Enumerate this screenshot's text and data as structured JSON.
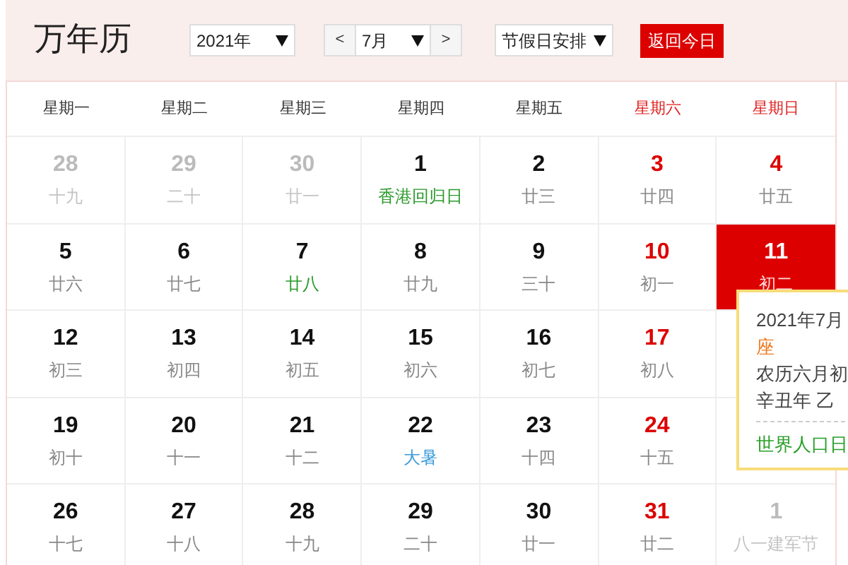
{
  "title": "万年历",
  "controls": {
    "year": "2021年",
    "prev": "<",
    "month": "7月",
    "next": ">",
    "holidays": "节假日安排",
    "today_button": "返回今日"
  },
  "weekdays": [
    {
      "label": "星期一",
      "weekend": false
    },
    {
      "label": "星期二",
      "weekend": false
    },
    {
      "label": "星期三",
      "weekend": false
    },
    {
      "label": "星期四",
      "weekend": false
    },
    {
      "label": "星期五",
      "weekend": false
    },
    {
      "label": "星期六",
      "weekend": true
    },
    {
      "label": "星期日",
      "weekend": true
    }
  ],
  "weeks": [
    [
      {
        "day": "28",
        "lunar": "十九",
        "other_month": true,
        "selected": false
      },
      {
        "day": "29",
        "lunar": "二十",
        "other_month": true,
        "selected": false
      },
      {
        "day": "30",
        "lunar": "廿一",
        "other_month": true,
        "selected": false
      },
      {
        "day": "1",
        "lunar": "香港回归日",
        "other_month": false,
        "selected": false,
        "color": "#2a9a2a"
      },
      {
        "day": "2",
        "lunar": "廿三",
        "other_month": false,
        "selected": false
      },
      {
        "day": "3",
        "lunar": "廿四",
        "other_month": false,
        "selected": false
      },
      {
        "day": "4",
        "lunar": "廿五",
        "other_month": false,
        "selected": false
      }
    ],
    [
      {
        "day": "5",
        "lunar": "廿六",
        "other_month": false,
        "selected": false
      },
      {
        "day": "6",
        "lunar": "廿七",
        "other_month": false,
        "selected": false
      },
      {
        "day": "7",
        "lunar": "廿八",
        "other_month": false,
        "selected": false,
        "color": "#2a9a2a"
      },
      {
        "day": "8",
        "lunar": "廿九",
        "other_month": false,
        "selected": false
      },
      {
        "day": "9",
        "lunar": "三十",
        "other_month": false,
        "selected": false
      },
      {
        "day": "10",
        "lunar": "初一",
        "other_month": false,
        "selected": false
      },
      {
        "day": "11",
        "lunar": "初二",
        "other_month": false,
        "selected": true
      }
    ],
    [
      {
        "day": "12",
        "lunar": "初三",
        "other_month": false,
        "selected": false
      },
      {
        "day": "13",
        "lunar": "初四",
        "other_month": false,
        "selected": false
      },
      {
        "day": "14",
        "lunar": "初五",
        "other_month": false,
        "selected": false
      },
      {
        "day": "15",
        "lunar": "初六",
        "other_month": false,
        "selected": false
      },
      {
        "day": "16",
        "lunar": "初七",
        "other_month": false,
        "selected": false
      },
      {
        "day": "17",
        "lunar": "初八",
        "other_month": false,
        "selected": false
      }
    ],
    [
      {
        "day": "19",
        "lunar": "初十",
        "other_month": false,
        "selected": false
      },
      {
        "day": "20",
        "lunar": "十一",
        "other_month": false,
        "selected": false
      },
      {
        "day": "21",
        "lunar": "十二",
        "other_month": false,
        "selected": false
      },
      {
        "day": "22",
        "lunar": "大暑",
        "other_month": false,
        "selected": false,
        "color": "#3a9ad9"
      },
      {
        "day": "23",
        "lunar": "十四",
        "other_month": false,
        "selected": false
      },
      {
        "day": "24",
        "lunar": "十五",
        "other_month": false,
        "selected": false
      }
    ],
    [
      {
        "day": "26",
        "lunar": "十七",
        "other_month": false,
        "selected": false
      },
      {
        "day": "27",
        "lunar": "十八",
        "other_month": false,
        "selected": false
      },
      {
        "day": "28",
        "lunar": "十九",
        "other_month": false,
        "selected": false
      },
      {
        "day": "29",
        "lunar": "二十",
        "other_month": false,
        "selected": false
      },
      {
        "day": "30",
        "lunar": "廿一",
        "other_month": false,
        "selected": false
      },
      {
        "day": "31",
        "lunar": "廿二",
        "other_month": false,
        "selected": false
      },
      {
        "day": "1",
        "lunar": "八一建军节",
        "other_month": true,
        "selected": false
      }
    ]
  ],
  "tooltip": {
    "date": "2021年7月",
    "constellation": "座",
    "lunar_date": "农历六月初",
    "ganzhi": "辛丑年 乙",
    "festival": "世界人口日"
  }
}
